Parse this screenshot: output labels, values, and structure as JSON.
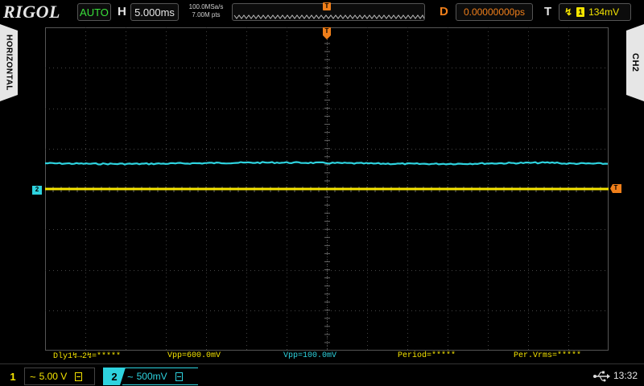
{
  "header": {
    "brand": "RIGOL",
    "run_status": "AUTO",
    "timebase_label": "H",
    "timebase_value": "5.000ms",
    "sample_rate": "100.0MSa/s",
    "memory_depth": "7.00M pts",
    "delay_label": "D",
    "delay_value": "0.00000000ps",
    "trigger_label": "T",
    "trigger_source": "1",
    "trigger_level": "134mV"
  },
  "side_tabs": {
    "left": "HORIZONTAL",
    "right": "CH2"
  },
  "markers": {
    "trigger_position": "T",
    "ch2_offset": "2",
    "trigger_level": "T"
  },
  "measurements": [
    "Dly1↯→2↯=*****",
    "Vpp=600.0mV",
    "Vpp=100.0mV",
    "Period=*****",
    "Per.Vrms=*****"
  ],
  "channels": [
    {
      "number": "1",
      "coupling": "~",
      "scale": "5.00 V",
      "color": "#f5e400"
    },
    {
      "number": "2",
      "coupling": "~",
      "scale": "500mV",
      "color": "#2ed3df"
    }
  ],
  "status": {
    "usb": "usb-icon",
    "time": "13:32"
  },
  "colors": {
    "ch1": "#f5e400",
    "ch2": "#2ed3df",
    "trigger": "#f07f1a",
    "run_status": "#39e03a"
  }
}
